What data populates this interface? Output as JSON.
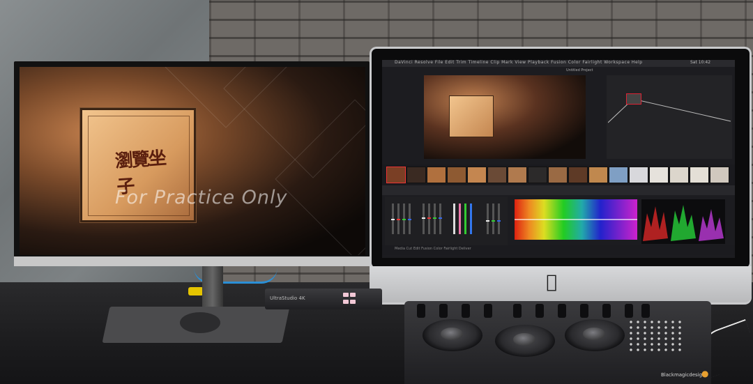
{
  "left_monitor": {
    "logo_text": "瀏覽坐子",
    "watermark": "For Practice Only"
  },
  "imac": {
    "menu_text": "DaVinci Resolve  File  Edit  Trim  Timeline  Clip  Mark  View  Playback  Fusion  Color  Fairlight  Workspace  Help",
    "clock_text": "Sat 10:42",
    "viewer_title": "Untitled Project",
    "page_nav_text": "Media   Cut   Edit   Fusion   Color   Fairlight   Deliver"
  },
  "ultrastudio": {
    "label": "UltraStudio 4K"
  },
  "panel": {
    "brand": "Blackmagicdesign"
  },
  "colors": {
    "accent_red": "#d23",
    "brand_orange": "#e8a030"
  },
  "icons": [
    "apple-logo",
    "blackmagic-logo"
  ]
}
